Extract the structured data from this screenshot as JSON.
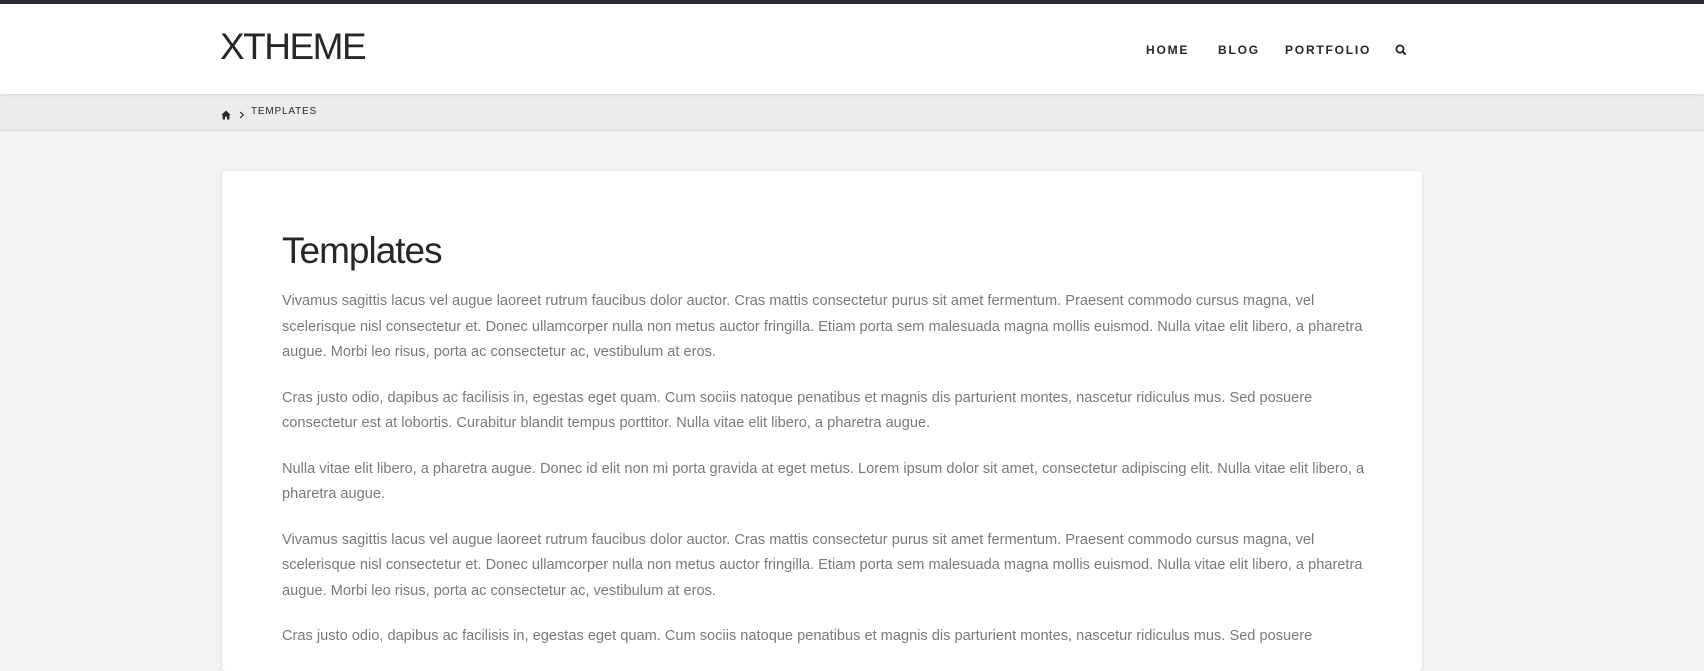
{
  "site": {
    "brand": "XTHEME"
  },
  "nav": {
    "items": [
      {
        "label": "HOME"
      },
      {
        "label": "BLOG"
      },
      {
        "label": "PORTFOLIO"
      }
    ],
    "search_icon": "search-icon"
  },
  "breadcrumb": {
    "home_icon": "home-icon",
    "separator_icon": "chevron-right-icon",
    "current": "TEMPLATES"
  },
  "page": {
    "title": "Templates",
    "paragraphs": [
      "Vivamus sagittis lacus vel augue laoreet rutrum faucibus dolor auctor. Cras mattis consectetur purus sit amet fermentum. Praesent commodo cursus magna, vel scelerisque nisl consectetur et. Donec ullamcorper nulla non metus auctor fringilla. Etiam porta sem malesuada magna mollis euismod. Nulla vitae elit libero, a pharetra augue. Morbi leo risus, porta ac consectetur ac, vestibulum at eros.",
      "Cras justo odio, dapibus ac facilisis in, egestas eget quam. Cum sociis natoque penatibus et magnis dis parturient montes, nascetur ridiculus mus. Sed posuere consectetur est at lobortis. Curabitur blandit tempus porttitor. Nulla vitae elit libero, a pharetra augue.",
      "Nulla vitae elit libero, a pharetra augue. Donec id elit non mi porta gravida at eget metus. Lorem ipsum dolor sit amet, consectetur adipiscing elit. Nulla vitae elit libero, a pharetra augue.",
      "Vivamus sagittis lacus vel augue laoreet rutrum faucibus dolor auctor. Cras mattis consectetur purus sit amet fermentum. Praesent commodo cursus magna, vel scelerisque nisl consectetur et. Donec ullamcorper nulla non metus auctor fringilla. Etiam porta sem malesuada magna mollis euismod. Nulla vitae elit libero, a pharetra augue. Morbi leo risus, porta ac consectetur ac, vestibulum at eros.",
      "Cras justo odio, dapibus ac facilisis in, egestas eget quam. Cum sociis natoque penatibus et magnis dis parturient montes, nascetur ridiculus mus. Sed posuere"
    ]
  },
  "colors": {
    "top_bar": "#272b2f",
    "heading": "#272727",
    "body_text": "#7a7a7a",
    "page_background": "#f3f3f3",
    "card_background": "#ffffff"
  }
}
